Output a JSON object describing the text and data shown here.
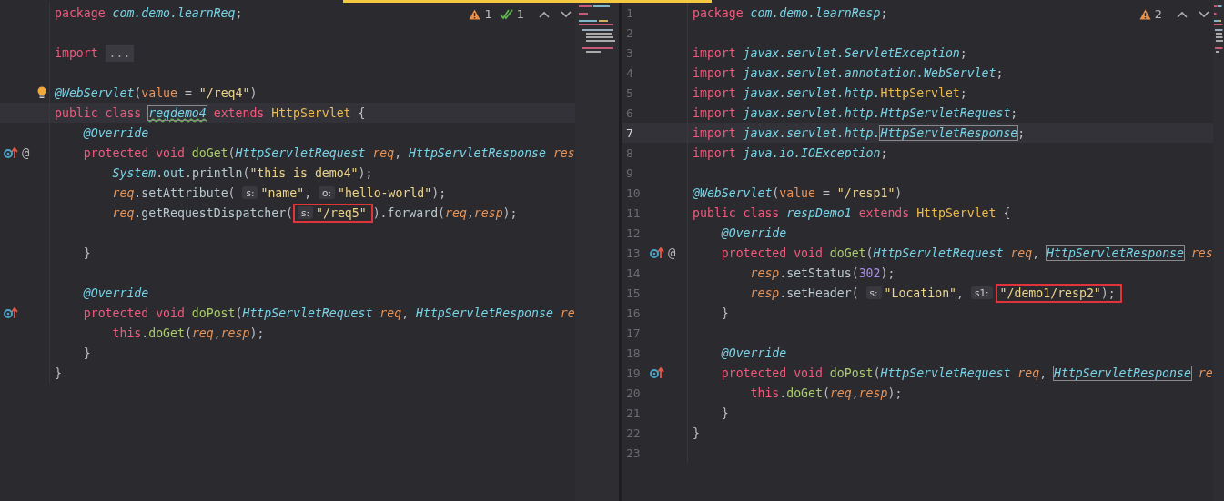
{
  "editors": [
    {
      "inspections": {
        "warnings": "1",
        "weak_warnings": "1"
      },
      "lines": [
        {
          "segments": [
            {
              "kind": "code",
              "tokens": [
                {
                  "kind": "kw",
                  "t": "package "
                },
                {
                  "kind": "pkg",
                  "t": "com.demo.learnReq"
                },
                {
                  "kind": "plain",
                  "t": ";"
                }
              ]
            }
          ]
        },
        {
          "kind": "blank"
        },
        {
          "segments": [
            {
              "kind": "code",
              "tokens": [
                {
                  "kind": "kw",
                  "t": "import "
                },
                {
                  "kind": "fold",
                  "t": "..."
                }
              ]
            }
          ]
        },
        {
          "kind": "blank"
        },
        {
          "bulb": true,
          "segments": [
            {
              "kind": "code",
              "tokens": [
                {
                  "kind": "ann",
                  "t": "@WebServlet"
                },
                {
                  "kind": "plain",
                  "t": "("
                },
                {
                  "kind": "attr",
                  "t": "value"
                },
                {
                  "kind": "plain",
                  "t": " = "
                },
                {
                  "kind": "str",
                  "t": "\"/req4\""
                },
                {
                  "kind": "plain",
                  "t": ")"
                }
              ]
            }
          ]
        },
        {
          "current": true,
          "segments": [
            {
              "kind": "code",
              "tokens": [
                {
                  "kind": "kw",
                  "t": "public class "
                }
              ]
            },
            {
              "kind": "code",
              "outlined": true,
              "squiggle": true,
              "tokens": [
                {
                  "kind": "itype",
                  "t": "reqdemo4"
                }
              ]
            },
            {
              "kind": "code",
              "tokens": [
                {
                  "kind": "kw",
                  "t": " extends "
                },
                {
                  "kind": "type",
                  "t": "HttpServlet"
                },
                {
                  "kind": "plain",
                  "t": " {"
                }
              ]
            }
          ]
        },
        {
          "segments": [
            {
              "kind": "code",
              "tokens": [
                {
                  "kind": "ann",
                  "t": "    @Override"
                }
              ]
            }
          ]
        },
        {
          "override": true,
          "marker": "@",
          "segments": [
            {
              "kind": "code",
              "tokens": [
                {
                  "kind": "kw",
                  "t": "    protected void "
                },
                {
                  "kind": "fn",
                  "t": "doGet"
                },
                {
                  "kind": "plain",
                  "t": "("
                },
                {
                  "kind": "itype",
                  "t": "HttpServletRequest"
                },
                {
                  "kind": "param",
                  "t": " req"
                },
                {
                  "kind": "plain",
                  "t": ", "
                },
                {
                  "kind": "itype",
                  "t": "HttpServletResponse"
                },
                {
                  "kind": "param",
                  "t": " res"
                }
              ]
            }
          ]
        },
        {
          "segments": [
            {
              "kind": "code",
              "tokens": [
                {
                  "kind": "itype",
                  "t": "        System"
                },
                {
                  "kind": "plain",
                  "t": "."
                },
                {
                  "kind": "field",
                  "t": "out"
                },
                {
                  "kind": "plain",
                  "t": "."
                },
                {
                  "kind": "call",
                  "t": "println"
                },
                {
                  "kind": "plain",
                  "t": "("
                },
                {
                  "kind": "str",
                  "t": "\"this is demo4\""
                },
                {
                  "kind": "plain",
                  "t": ");"
                }
              ]
            }
          ]
        },
        {
          "segments": [
            {
              "kind": "code",
              "tokens": [
                {
                  "kind": "param",
                  "t": "        req"
                },
                {
                  "kind": "plain",
                  "t": "."
                },
                {
                  "kind": "call",
                  "t": "setAttribute"
                },
                {
                  "kind": "plain",
                  "t": "( "
                }
              ]
            },
            {
              "kind": "hint",
              "text": "s:"
            },
            {
              "kind": "code",
              "tokens": [
                {
                  "kind": "str",
                  "t": "\"name\""
                },
                {
                  "kind": "plain",
                  "t": ", "
                }
              ]
            },
            {
              "kind": "hint",
              "text": "o:"
            },
            {
              "kind": "code",
              "tokens": [
                {
                  "kind": "str",
                  "t": "\"hello-world\""
                },
                {
                  "kind": "plain",
                  "t": ");"
                }
              ]
            }
          ]
        },
        {
          "segments": [
            {
              "kind": "code",
              "tokens": [
                {
                  "kind": "param",
                  "t": "        req"
                },
                {
                  "kind": "plain",
                  "t": "."
                },
                {
                  "kind": "call",
                  "t": "getRequestDispatcher"
                },
                {
                  "kind": "plain",
                  "t": "("
                }
              ]
            },
            {
              "kind": "frame",
              "segments": [
                {
                  "kind": "hint",
                  "text": "s:"
                },
                {
                  "kind": "code",
                  "tokens": [
                    {
                      "kind": "str",
                      "t": "\"/req5\""
                    }
                  ]
                }
              ]
            },
            {
              "kind": "code",
              "tokens": [
                {
                  "kind": "plain",
                  "t": ")."
                },
                {
                  "kind": "call",
                  "t": "forward"
                },
                {
                  "kind": "plain",
                  "t": "("
                },
                {
                  "kind": "param",
                  "t": "req"
                },
                {
                  "kind": "plain",
                  "t": ","
                },
                {
                  "kind": "param",
                  "t": "resp"
                },
                {
                  "kind": "plain",
                  "t": ");"
                }
              ]
            }
          ]
        },
        {
          "kind": "blank"
        },
        {
          "segments": [
            {
              "kind": "code",
              "tokens": [
                {
                  "kind": "plain",
                  "t": "    }"
                }
              ]
            }
          ]
        },
        {
          "kind": "blank"
        },
        {
          "segments": [
            {
              "kind": "code",
              "tokens": [
                {
                  "kind": "ann",
                  "t": "    @Override"
                }
              ]
            }
          ]
        },
        {
          "override": true,
          "segments": [
            {
              "kind": "code",
              "tokens": [
                {
                  "kind": "kw",
                  "t": "    protected void "
                },
                {
                  "kind": "fn",
                  "t": "doPost"
                },
                {
                  "kind": "plain",
                  "t": "("
                },
                {
                  "kind": "itype",
                  "t": "HttpServletRequest"
                },
                {
                  "kind": "param",
                  "t": " req"
                },
                {
                  "kind": "plain",
                  "t": ", "
                },
                {
                  "kind": "itype",
                  "t": "HttpServletResponse"
                },
                {
                  "kind": "param",
                  "t": " re"
                }
              ]
            }
          ]
        },
        {
          "segments": [
            {
              "kind": "code",
              "tokens": [
                {
                  "kind": "kw",
                  "t": "        this"
                },
                {
                  "kind": "plain",
                  "t": "."
                },
                {
                  "kind": "fn",
                  "t": "doGet"
                },
                {
                  "kind": "plain",
                  "t": "("
                },
                {
                  "kind": "param",
                  "t": "req"
                },
                {
                  "kind": "plain",
                  "t": ","
                },
                {
                  "kind": "param",
                  "t": "resp"
                },
                {
                  "kind": "plain",
                  "t": ");"
                }
              ]
            }
          ]
        },
        {
          "segments": [
            {
              "kind": "code",
              "tokens": [
                {
                  "kind": "plain",
                  "t": "    }"
                }
              ]
            }
          ]
        },
        {
          "segments": [
            {
              "kind": "code",
              "tokens": [
                {
                  "kind": "plain",
                  "t": "}"
                }
              ]
            }
          ]
        }
      ]
    },
    {
      "inspections": {
        "warnings": "2"
      },
      "lines": [
        {
          "number": "1",
          "segments": [
            {
              "kind": "code",
              "tokens": [
                {
                  "kind": "kw",
                  "t": "package "
                },
                {
                  "kind": "pkg",
                  "t": "com.demo.learnResp"
                },
                {
                  "kind": "plain",
                  "t": ";"
                }
              ]
            }
          ]
        },
        {
          "number": "2"
        },
        {
          "number": "3",
          "segments": [
            {
              "kind": "code",
              "tokens": [
                {
                  "kind": "kw",
                  "t": "import "
                },
                {
                  "kind": "pkg",
                  "t": "javax.servlet.ServletException"
                },
                {
                  "kind": "plain",
                  "t": ";"
                }
              ]
            }
          ]
        },
        {
          "number": "4",
          "segments": [
            {
              "kind": "code",
              "tokens": [
                {
                  "kind": "kw",
                  "t": "import "
                },
                {
                  "kind": "pkg",
                  "t": "javax.servlet.annotation.WebServlet"
                },
                {
                  "kind": "plain",
                  "t": ";"
                }
              ]
            }
          ]
        },
        {
          "number": "5",
          "segments": [
            {
              "kind": "code",
              "tokens": [
                {
                  "kind": "kw",
                  "t": "import "
                },
                {
                  "kind": "pkg",
                  "t": "javax.servlet.http."
                },
                {
                  "kind": "type",
                  "t": "HttpServlet"
                },
                {
                  "kind": "plain",
                  "t": ";"
                }
              ]
            }
          ]
        },
        {
          "number": "6",
          "segments": [
            {
              "kind": "code",
              "tokens": [
                {
                  "kind": "kw",
                  "t": "import "
                },
                {
                  "kind": "pkg",
                  "t": "javax.servlet.http.HttpServletRequest"
                },
                {
                  "kind": "plain",
                  "t": ";"
                }
              ]
            }
          ]
        },
        {
          "number": "7",
          "current": true,
          "segments": [
            {
              "kind": "code",
              "tokens": [
                {
                  "kind": "kw",
                  "t": "import "
                },
                {
                  "kind": "pkg",
                  "t": "javax.servlet.http."
                }
              ]
            },
            {
              "kind": "code",
              "outlined": true,
              "tokens": [
                {
                  "kind": "itype",
                  "t": "HttpServletResponse"
                }
              ]
            },
            {
              "kind": "code",
              "tokens": [
                {
                  "kind": "plain",
                  "t": ";"
                }
              ]
            }
          ]
        },
        {
          "number": "8",
          "segments": [
            {
              "kind": "code",
              "tokens": [
                {
                  "kind": "kw",
                  "t": "import "
                },
                {
                  "kind": "pkg",
                  "t": "java.io.IOException"
                },
                {
                  "kind": "plain",
                  "t": ";"
                }
              ]
            }
          ]
        },
        {
          "number": "9"
        },
        {
          "number": "10",
          "segments": [
            {
              "kind": "code",
              "tokens": [
                {
                  "kind": "ann",
                  "t": "@WebServlet"
                },
                {
                  "kind": "plain",
                  "t": "("
                },
                {
                  "kind": "attr",
                  "t": "value"
                },
                {
                  "kind": "plain",
                  "t": " = "
                },
                {
                  "kind": "str",
                  "t": "\"/resp1\""
                },
                {
                  "kind": "plain",
                  "t": ")"
                }
              ]
            }
          ]
        },
        {
          "number": "11",
          "segments": [
            {
              "kind": "code",
              "tokens": [
                {
                  "kind": "kw",
                  "t": "public class "
                },
                {
                  "kind": "itype",
                  "t": "respDemo1"
                },
                {
                  "kind": "kw",
                  "t": " extends "
                },
                {
                  "kind": "type",
                  "t": "HttpServlet"
                },
                {
                  "kind": "plain",
                  "t": " {"
                }
              ]
            }
          ]
        },
        {
          "number": "12",
          "segments": [
            {
              "kind": "code",
              "tokens": [
                {
                  "kind": "ann",
                  "t": "    @Override"
                }
              ]
            }
          ]
        },
        {
          "number": "13",
          "override": true,
          "marker": "@",
          "segments": [
            {
              "kind": "code",
              "tokens": [
                {
                  "kind": "kw",
                  "t": "    protected void "
                },
                {
                  "kind": "fn",
                  "t": "doGet"
                },
                {
                  "kind": "plain",
                  "t": "("
                },
                {
                  "kind": "itype",
                  "t": "HttpServletRequest"
                },
                {
                  "kind": "param",
                  "t": " req"
                },
                {
                  "kind": "plain",
                  "t": ", "
                }
              ]
            },
            {
              "kind": "code",
              "outlined": true,
              "tokens": [
                {
                  "kind": "itype",
                  "t": "HttpServletResponse"
                }
              ]
            },
            {
              "kind": "code",
              "tokens": [
                {
                  "kind": "param",
                  "t": " res"
                }
              ]
            }
          ]
        },
        {
          "number": "14",
          "segments": [
            {
              "kind": "code",
              "tokens": [
                {
                  "kind": "param",
                  "t": "        resp"
                },
                {
                  "kind": "plain",
                  "t": "."
                },
                {
                  "kind": "call",
                  "t": "setStatus"
                },
                {
                  "kind": "plain",
                  "t": "("
                },
                {
                  "kind": "num",
                  "t": "302"
                },
                {
                  "kind": "plain",
                  "t": ");"
                }
              ]
            }
          ]
        },
        {
          "number": "15",
          "segments": [
            {
              "kind": "code",
              "tokens": [
                {
                  "kind": "param",
                  "t": "        resp"
                },
                {
                  "kind": "plain",
                  "t": "."
                },
                {
                  "kind": "call",
                  "t": "setHeader"
                },
                {
                  "kind": "plain",
                  "t": "( "
                }
              ]
            },
            {
              "kind": "hint",
              "text": "s:"
            },
            {
              "kind": "code",
              "tokens": [
                {
                  "kind": "str",
                  "t": "\"Location\""
                },
                {
                  "kind": "plain",
                  "t": ", "
                }
              ]
            },
            {
              "kind": "hint",
              "text": "s1:"
            },
            {
              "kind": "frame",
              "segments": [
                {
                  "kind": "code",
                  "tokens": [
                    {
                      "kind": "str",
                      "t": "\"/demo1/resp2\""
                    },
                    {
                      "kind": "plain",
                      "t": ");"
                    }
                  ]
                }
              ]
            }
          ]
        },
        {
          "number": "16",
          "segments": [
            {
              "kind": "code",
              "tokens": [
                {
                  "kind": "plain",
                  "t": "    }"
                }
              ]
            }
          ]
        },
        {
          "number": "17"
        },
        {
          "number": "18",
          "segments": [
            {
              "kind": "code",
              "tokens": [
                {
                  "kind": "ann",
                  "t": "    @Override"
                }
              ]
            }
          ]
        },
        {
          "number": "19",
          "override": true,
          "segments": [
            {
              "kind": "code",
              "tokens": [
                {
                  "kind": "kw",
                  "t": "    protected void "
                },
                {
                  "kind": "fn",
                  "t": "doPost"
                },
                {
                  "kind": "plain",
                  "t": "("
                },
                {
                  "kind": "itype",
                  "t": "HttpServletRequest"
                },
                {
                  "kind": "param",
                  "t": " req"
                },
                {
                  "kind": "plain",
                  "t": ", "
                }
              ]
            },
            {
              "kind": "code",
              "outlined": true,
              "tokens": [
                {
                  "kind": "itype",
                  "t": "HttpServletResponse"
                }
              ]
            },
            {
              "kind": "code",
              "tokens": [
                {
                  "kind": "param",
                  "t": " re"
                }
              ]
            }
          ]
        },
        {
          "number": "20",
          "segments": [
            {
              "kind": "code",
              "tokens": [
                {
                  "kind": "kw",
                  "t": "        this"
                },
                {
                  "kind": "plain",
                  "t": "."
                },
                {
                  "kind": "fn",
                  "t": "doGet"
                },
                {
                  "kind": "plain",
                  "t": "("
                },
                {
                  "kind": "param",
                  "t": "req"
                },
                {
                  "kind": "plain",
                  "t": ","
                },
                {
                  "kind": "param",
                  "t": "resp"
                },
                {
                  "kind": "plain",
                  "t": ");"
                }
              ]
            }
          ]
        },
        {
          "number": "21",
          "segments": [
            {
              "kind": "code",
              "tokens": [
                {
                  "kind": "plain",
                  "t": "    }"
                }
              ]
            }
          ]
        },
        {
          "number": "22",
          "segments": [
            {
              "kind": "code",
              "tokens": [
                {
                  "kind": "plain",
                  "t": "}"
                }
              ]
            }
          ]
        },
        {
          "number": "23"
        }
      ]
    }
  ]
}
